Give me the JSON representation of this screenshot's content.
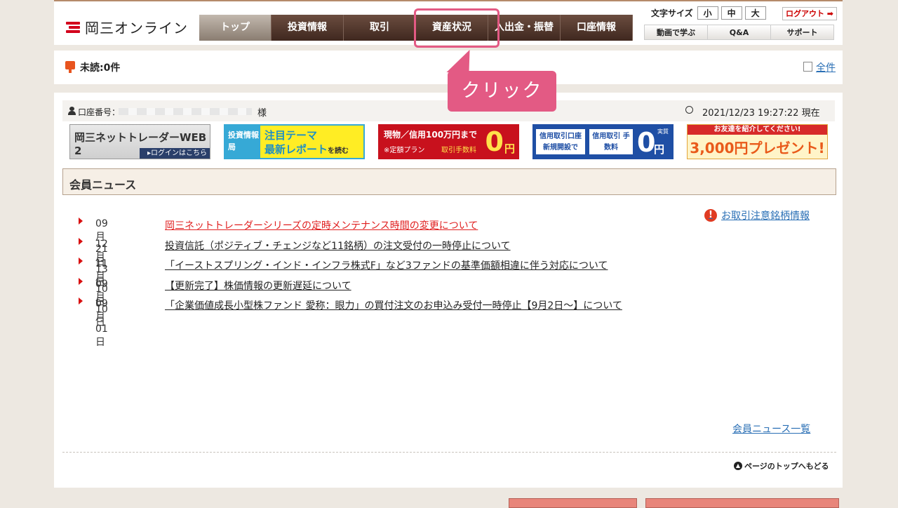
{
  "header": {
    "logo_text": "岡三オンライン",
    "nav_tabs": [
      {
        "label": "トップ",
        "active": true
      },
      {
        "label": "投資情報",
        "active": false
      },
      {
        "label": "取引",
        "active": false
      },
      {
        "label": "資産状況",
        "active": false
      },
      {
        "label": "入出金・振替",
        "active": false
      },
      {
        "label": "口座情報",
        "active": false
      }
    ],
    "font_size_label": "文字サイズ",
    "font_sizes": [
      "小",
      "中",
      "大"
    ],
    "logout_label": "ログアウト ➡",
    "sub_links": [
      "動画で学ぶ",
      "Q&A",
      "サポート"
    ]
  },
  "unread": {
    "label": "未読:0件",
    "all_label": "全件"
  },
  "account": {
    "number_label": "口座番号：",
    "honorific": "様",
    "datetime": "2021/12/23 19:27:22 現在"
  },
  "banners": {
    "web2": {
      "title": "岡三ネットトレーダーWEB 2",
      "link": "▸ログインはこちら"
    },
    "theme": {
      "left": "投資情報局",
      "line1": "注目テーマ",
      "line2": "最新レポート",
      "line2_suffix": "を読む"
    },
    "free": {
      "line1": "現物／信用100万円まで",
      "plan": "※定額プラン",
      "fee": "取引手数料",
      "zero": "0",
      "yen": "円"
    },
    "margin": {
      "left": "信用取引口座 新規開設で",
      "mid": "信用取引 手数料",
      "zero": "0",
      "yen": "円",
      "note": "実質"
    },
    "friend": {
      "line1": "お友達を紹介してください!",
      "line2": "3,000円プレゼント!"
    }
  },
  "news": {
    "heading": "会員ニュース",
    "alert_label": "お取引注意銘柄情報",
    "items": [
      {
        "date": "09月21日",
        "title": "岡三ネットトレーダーシリーズの定時メンテナンス時間の変更について",
        "highlight": true
      },
      {
        "date": "12月13日",
        "title": "投資信託（ポジティブ・チェンジなど11銘柄）の注文受付の一時停止について",
        "highlight": false
      },
      {
        "date": "11月10日",
        "title": "「イーストスプリング・インド・インフラ株式F」など3ファンドの基準価額相違に伴う対応について",
        "highlight": false
      },
      {
        "date": "09月10日",
        "title": "【更新完了】株価情報の更新遅延について",
        "highlight": false
      },
      {
        "date": "09月01日",
        "title": "「企業価値成長小型株ファンド 愛称：眼力」の買付注文のお申込み受付一時停止【9月2日〜】について",
        "highlight": false
      }
    ],
    "more_label": "会員ニュース一覧"
  },
  "page_top_label": "ページのトップへもどる",
  "annotation": {
    "callout_text": "クリック",
    "color": "#e35a84"
  }
}
